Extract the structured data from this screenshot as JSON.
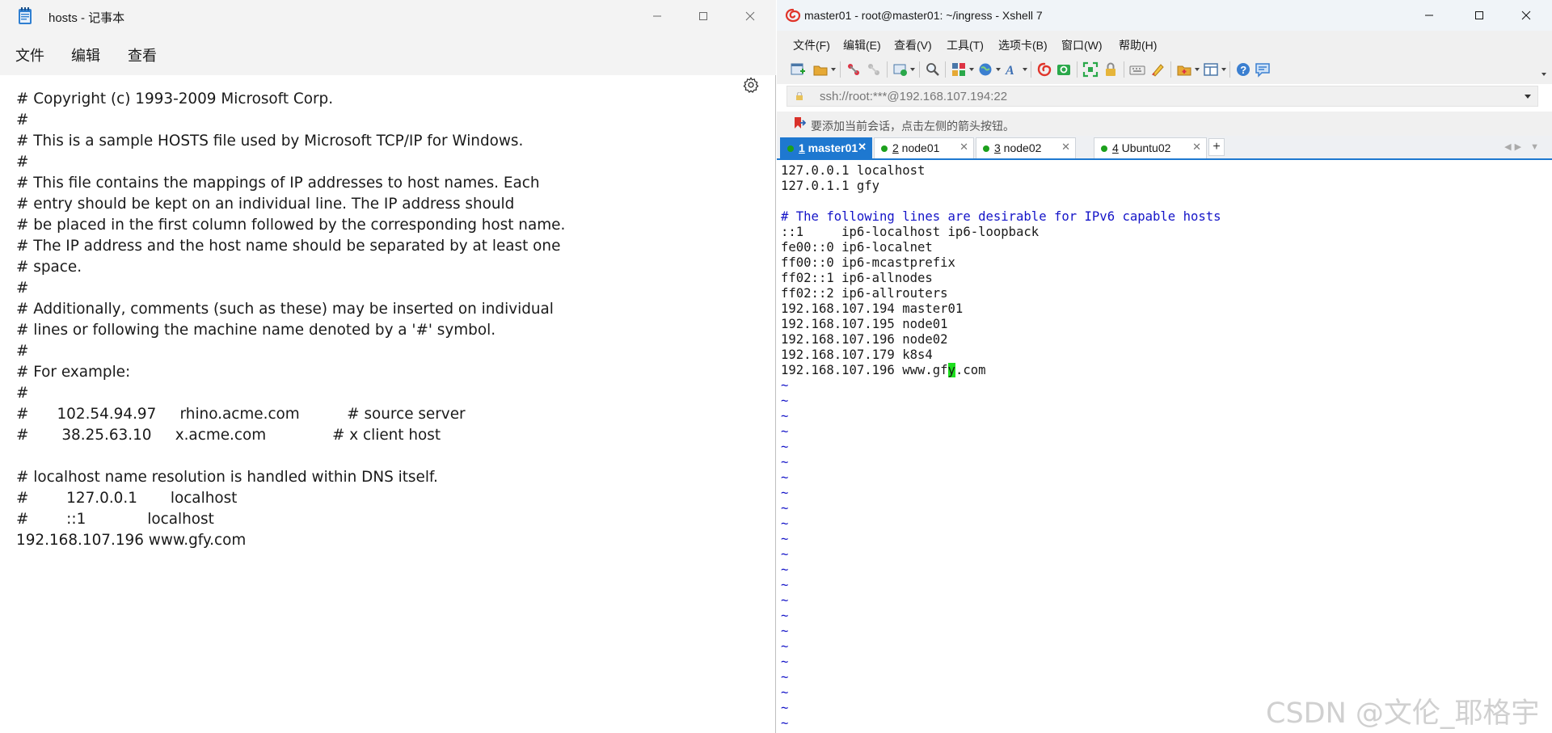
{
  "notepad": {
    "title": "hosts - 记事本",
    "menu": [
      "文件",
      "编辑",
      "查看"
    ],
    "lines": [
      "# Copyright (c) 1993-2009 Microsoft Corp.",
      "#",
      "# This is a sample HOSTS file used by Microsoft TCP/IP for Windows.",
      "#",
      "# This file contains the mappings of IP addresses to host names. Each",
      "# entry should be kept on an individual line. The IP address should",
      "# be placed in the first column followed by the corresponding host name.",
      "# The IP address and the host name should be separated by at least one",
      "# space.",
      "#",
      "# Additionally, comments (such as these) may be inserted on individual",
      "# lines or following the machine name denoted by a '#' symbol.",
      "#",
      "# For example:",
      "#",
      "#      102.54.94.97     rhino.acme.com          # source server",
      "#       38.25.63.10     x.acme.com              # x client host",
      "",
      "# localhost name resolution is handled within DNS itself.",
      "#        127.0.0.1       localhost",
      "#        ::1             localhost",
      "192.168.107.196 www.gfy.com"
    ]
  },
  "xshell": {
    "title": "master01 - root@master01: ~/ingress - Xshell 7",
    "menu": [
      "文件(F)",
      "编辑(E)",
      "查看(V)",
      "工具(T)",
      "选项卡(B)",
      "窗口(W)",
      "帮助(H)"
    ],
    "address": "ssh://root:***@192.168.107.194:22",
    "hint": "要添加当前会话，点击左侧的箭头按钮。",
    "tabs": [
      {
        "num": "1",
        "name": " master01",
        "active": true
      },
      {
        "num": "2",
        "name": " node01"
      },
      {
        "num": "3",
        "name": " node02"
      },
      {
        "num": "4",
        "name": " Ubuntu02"
      }
    ],
    "terminal": {
      "lines": [
        "127.0.0.1 localhost",
        "127.0.1.1 gfy",
        "",
        "# The following lines are desirable for IPv6 capable hosts",
        "::1     ip6-localhost ip6-loopback",
        "fe00::0 ip6-localnet",
        "ff00::0 ip6-mcastprefix",
        "ff02::1 ip6-allnodes",
        "ff02::2 ip6-allrouters",
        "192.168.107.194 master01",
        "192.168.107.195 node01",
        "192.168.107.196 node02",
        "192.168.107.179 k8s4"
      ],
      "last_line_before_cursor": "192.168.107.196 www.gf",
      "cursor_char": "y",
      "last_line_after_cursor": ".com",
      "tilde": "~",
      "tilde_count": 23
    }
  },
  "watermark": "CSDN @文伦_耶格宇",
  "colors": {
    "tab_active": "#1e78d0",
    "vim_tilde": "#1515c8",
    "cursor": "#1ee01e",
    "session_dot": "#1ca01c"
  }
}
